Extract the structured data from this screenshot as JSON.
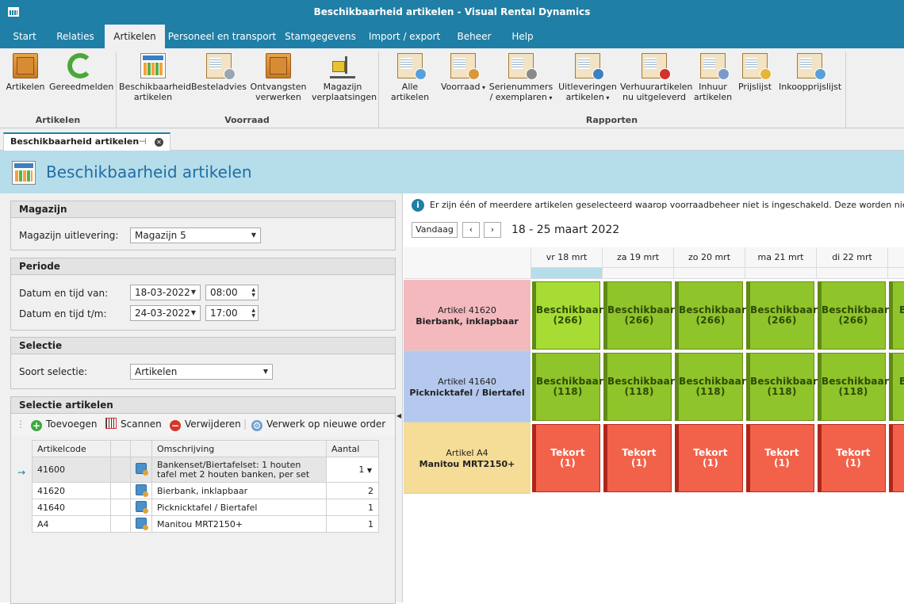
{
  "window": {
    "title": "Beschikbaarheid artikelen - Visual Rental Dynamics"
  },
  "menu": [
    {
      "label": "Start",
      "active": false
    },
    {
      "label": "Relaties",
      "active": false
    },
    {
      "label": "Artikelen",
      "active": true
    },
    {
      "label": "Personeel en transport",
      "active": false
    },
    {
      "label": "Stamgegevens",
      "active": false
    },
    {
      "label": "Import / export",
      "active": false
    },
    {
      "label": "Beheer",
      "active": false
    },
    {
      "label": "Help",
      "active": false
    }
  ],
  "ribbon": {
    "groups": [
      "Artikelen",
      "Voorraad",
      "Rapporten"
    ],
    "buttons": [
      {
        "label": "Artikelen",
        "icon": "box-icon"
      },
      {
        "label": "Gereedmelden",
        "icon": "refresh-icon"
      },
      {
        "label": "Beschikbaarheid artikelen",
        "icon": "calendar-icon"
      },
      {
        "label": "Besteladvies",
        "icon": "clipboard-clock-icon"
      },
      {
        "label": "Ontvangsten verwerken",
        "icon": "box-add-icon"
      },
      {
        "label": "Magazijn verplaatsingen",
        "icon": "forklift-icon"
      },
      {
        "label": "Alle artikelen",
        "icon": "report-list-icon"
      },
      {
        "label": "Voorraad",
        "icon": "report-warehouse-icon"
      },
      {
        "label": "Serienummers / exemplaren",
        "icon": "report-serial-icon"
      },
      {
        "label": "Uitleveringen artikelen",
        "icon": "report-truck-icon"
      },
      {
        "label": "Verhuurartikelen nu uitgeleverd",
        "icon": "report-cross-icon"
      },
      {
        "label": "Inhuur artikelen",
        "icon": "report-hire-icon"
      },
      {
        "label": "Prijslijst",
        "icon": "report-price-icon"
      },
      {
        "label": "Inkoopprijslijst",
        "icon": "report-purchase-icon"
      }
    ]
  },
  "doctab": {
    "label": "Beschikbaarheid artikelen"
  },
  "page": {
    "title": "Beschikbaarheid artikelen"
  },
  "form": {
    "magazijn": {
      "header": "Magazijn",
      "label": "Magazijn uitlevering:",
      "value": "Magazijn 5"
    },
    "periode": {
      "header": "Periode",
      "from_label": "Datum en tijd van:",
      "from_date": "18-03-2022",
      "from_time": "08:00",
      "to_label": "Datum en tijd t/m:",
      "to_date": "24-03-2022",
      "to_time": "17:00"
    },
    "selectie": {
      "header": "Selectie",
      "label": "Soort selectie:",
      "value": "Artikelen"
    },
    "artikelen": {
      "header": "Selectie artikelen",
      "toolbar": {
        "add": "Toevoegen",
        "scan": "Scannen",
        "remove": "Verwijderen",
        "process": "Verwerk op nieuwe order"
      },
      "columns": [
        "Artikelcode",
        "",
        "",
        "Omschrijving",
        "Aantal"
      ],
      "rows": [
        {
          "code": "41600",
          "desc": "Bankenset/Biertafelset: 1 houten tafel met 2 houten banken, per set",
          "qty": "1",
          "current": true
        },
        {
          "code": "41620",
          "desc": "Bierbank, inklapbaar",
          "qty": "2",
          "current": false
        },
        {
          "code": "41640",
          "desc": "Picknicktafel / Biertafel",
          "qty": "1",
          "current": false
        },
        {
          "code": "A4",
          "desc": "Manitou MRT2150+",
          "qty": "1",
          "current": false
        }
      ]
    }
  },
  "schedule": {
    "info": "Er zijn één of meerdere artikelen geselecteerd waarop voorraadbeheer niet is ingeschakeld. Deze worden niet weergegeven",
    "today_label": "Vandaag",
    "range": "18 - 25 maart 2022",
    "days": [
      "vr 18 mrt",
      "za 19 mrt",
      "zo 20 mrt",
      "ma 21 mrt",
      "di 22 mrt"
    ],
    "rows": [
      {
        "line1": "Artikel 41620",
        "line2": "Bierbank, inklapbaar",
        "bg": "#f4b9bd",
        "status": "Beschikbaar",
        "count": "(266)",
        "cell": "#8fc42b"
      },
      {
        "line1": "Artikel 41640",
        "line2": "Picknicktafel / Biertafel",
        "bg": "#b5c9ee",
        "status": "Beschikbaar",
        "count": "(118)",
        "cell": "#8fc42b"
      },
      {
        "line1": "Artikel A4",
        "line2": "Manitou MRT2150+",
        "bg": "#f5dc97",
        "status": "Tekort",
        "count": "(1)",
        "cell": "#f2624a"
      }
    ],
    "first_cell_highlight": "#a6dc34",
    "partial_next": "B"
  }
}
